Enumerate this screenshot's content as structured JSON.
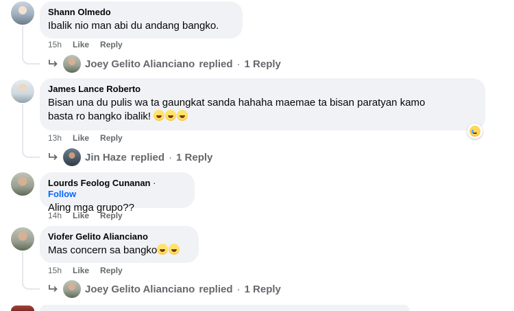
{
  "comments": [
    {
      "name": "Shann Olmedo",
      "text": "Ibalik nio man abi du andang bangko.",
      "time": "15h",
      "like": "Like",
      "reply": "Reply",
      "replies": {
        "name": "Joey Gelito Alianciano",
        "verb": "replied",
        "sep": "·",
        "count": "1 Reply"
      }
    },
    {
      "name": "James Lance Roberto",
      "text_line1": "Bisan una du pulis wa ta gaungkat sanda hahaha maemae ta bisan paratyan kamo",
      "text_line2": "basta ro bangko ibalik!",
      "time": "13h",
      "like": "Like",
      "reply": "Reply",
      "reaction_icon": "sad-cry-emoji-icon",
      "replies": {
        "name": "Jin Haze",
        "verb": "replied",
        "sep": "·",
        "count": "1 Reply"
      }
    },
    {
      "name": "Lourds Feolog Cunanan",
      "dot": "·",
      "follow": "Follow",
      "text": "Aling mga grupo??",
      "time": "14h",
      "like": "Like",
      "reply": "Reply"
    },
    {
      "name": "Viofer Gelito Alianciano",
      "text": "Mas concern sa bangko",
      "time": "15h",
      "like": "Like",
      "reply": "Reply",
      "replies": {
        "name": "Joey Gelito Alianciano",
        "verb": "replied",
        "sep": "·",
        "count": "1 Reply"
      }
    }
  ],
  "colors": {
    "bubble": "#f0f2f5",
    "meta": "#65676b",
    "link": "#0866ff",
    "text": "#050505"
  }
}
